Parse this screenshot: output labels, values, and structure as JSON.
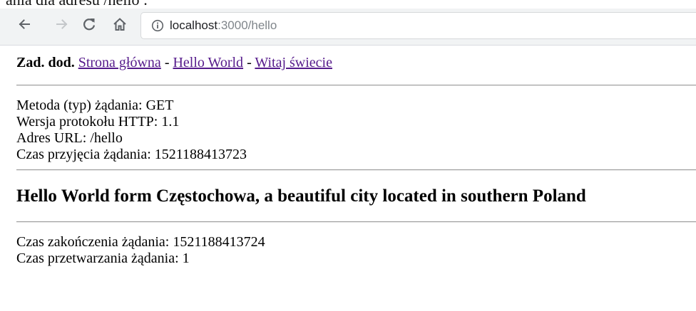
{
  "caption": "ania dla adresu /hello :",
  "browser": {
    "url_host": "localhost",
    "url_rest": ":3000/hello",
    "icons": {
      "back": "back-arrow-icon",
      "forward": "forward-arrow-icon",
      "reload": "reload-icon",
      "home": "home-icon",
      "info": "info-icon"
    }
  },
  "page": {
    "nav": {
      "label": "Zad. dod.",
      "separator": "-",
      "links": [
        "Strona główna",
        "Hello World",
        "Witaj świecie"
      ]
    },
    "request_info": [
      "Metoda (typ) żądania: GET",
      "Wersja protokołu HTTP: 1.1",
      "Adres URL: /hello",
      "Czas przyjęcia żądania: 1521188413723"
    ],
    "heading": "Hello World form Częstochowa, a beautiful city located in southern Poland",
    "timing_info": [
      "Czas zakończenia żądania: 1521188413724",
      "Czas przetwarzania żądania: 1"
    ]
  }
}
